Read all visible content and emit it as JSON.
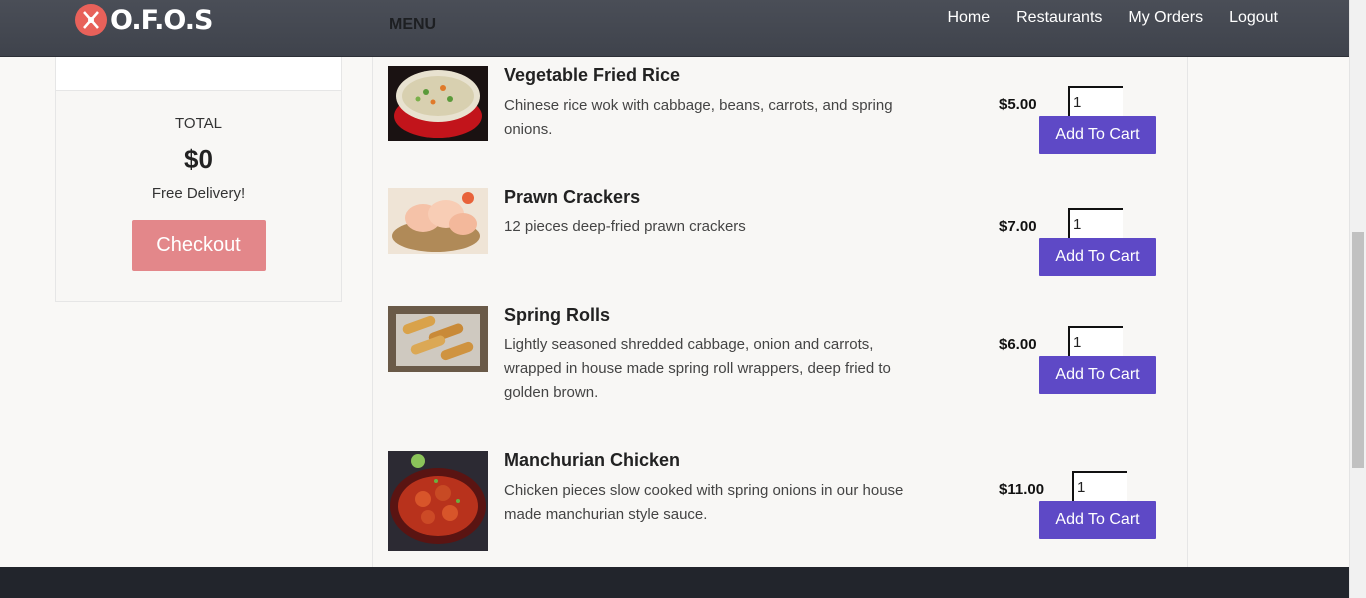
{
  "navbar": {
    "brand": "O.F.O.S",
    "menu_label": "MENU",
    "links": [
      "Home",
      "Restaurants",
      "My Orders",
      "Logout"
    ]
  },
  "cart": {
    "total_label": "TOTAL",
    "total_value": "$0",
    "delivery_text": "Free Delivery!",
    "checkout_label": "Checkout"
  },
  "menu": {
    "items": [
      {
        "name": "Vegetable Fried Rice",
        "description": "Chinese rice wok with cabbage, beans, carrots, and spring onions.",
        "price": "$5.00",
        "quantity": "1",
        "button": "Add To Cart",
        "image": "fried-rice-photo"
      },
      {
        "name": "Prawn Crackers",
        "description": "12 pieces deep-fried prawn crackers",
        "price": "$7.00",
        "quantity": "1",
        "button": "Add To Cart",
        "image": "prawn-crackers-photo"
      },
      {
        "name": "Spring Rolls",
        "description": "Lightly seasoned shredded cabbage, onion and carrots, wrapped in house made spring roll wrappers, deep fried to golden brown.",
        "price": "$6.00",
        "quantity": "1",
        "button": "Add To Cart",
        "image": "spring-rolls-photo"
      },
      {
        "name": "Manchurian Chicken",
        "description": "Chicken pieces slow cooked with spring onions in our house made manchurian style sauce.",
        "price": "$11.00",
        "quantity": "1",
        "button": "Add To Cart",
        "image": "manchurian-chicken-photo"
      }
    ]
  },
  "colors": {
    "navbar": "#434750",
    "accent_button": "#5e49c6",
    "checkout_button": "#e3878a",
    "footer": "#22252c"
  }
}
